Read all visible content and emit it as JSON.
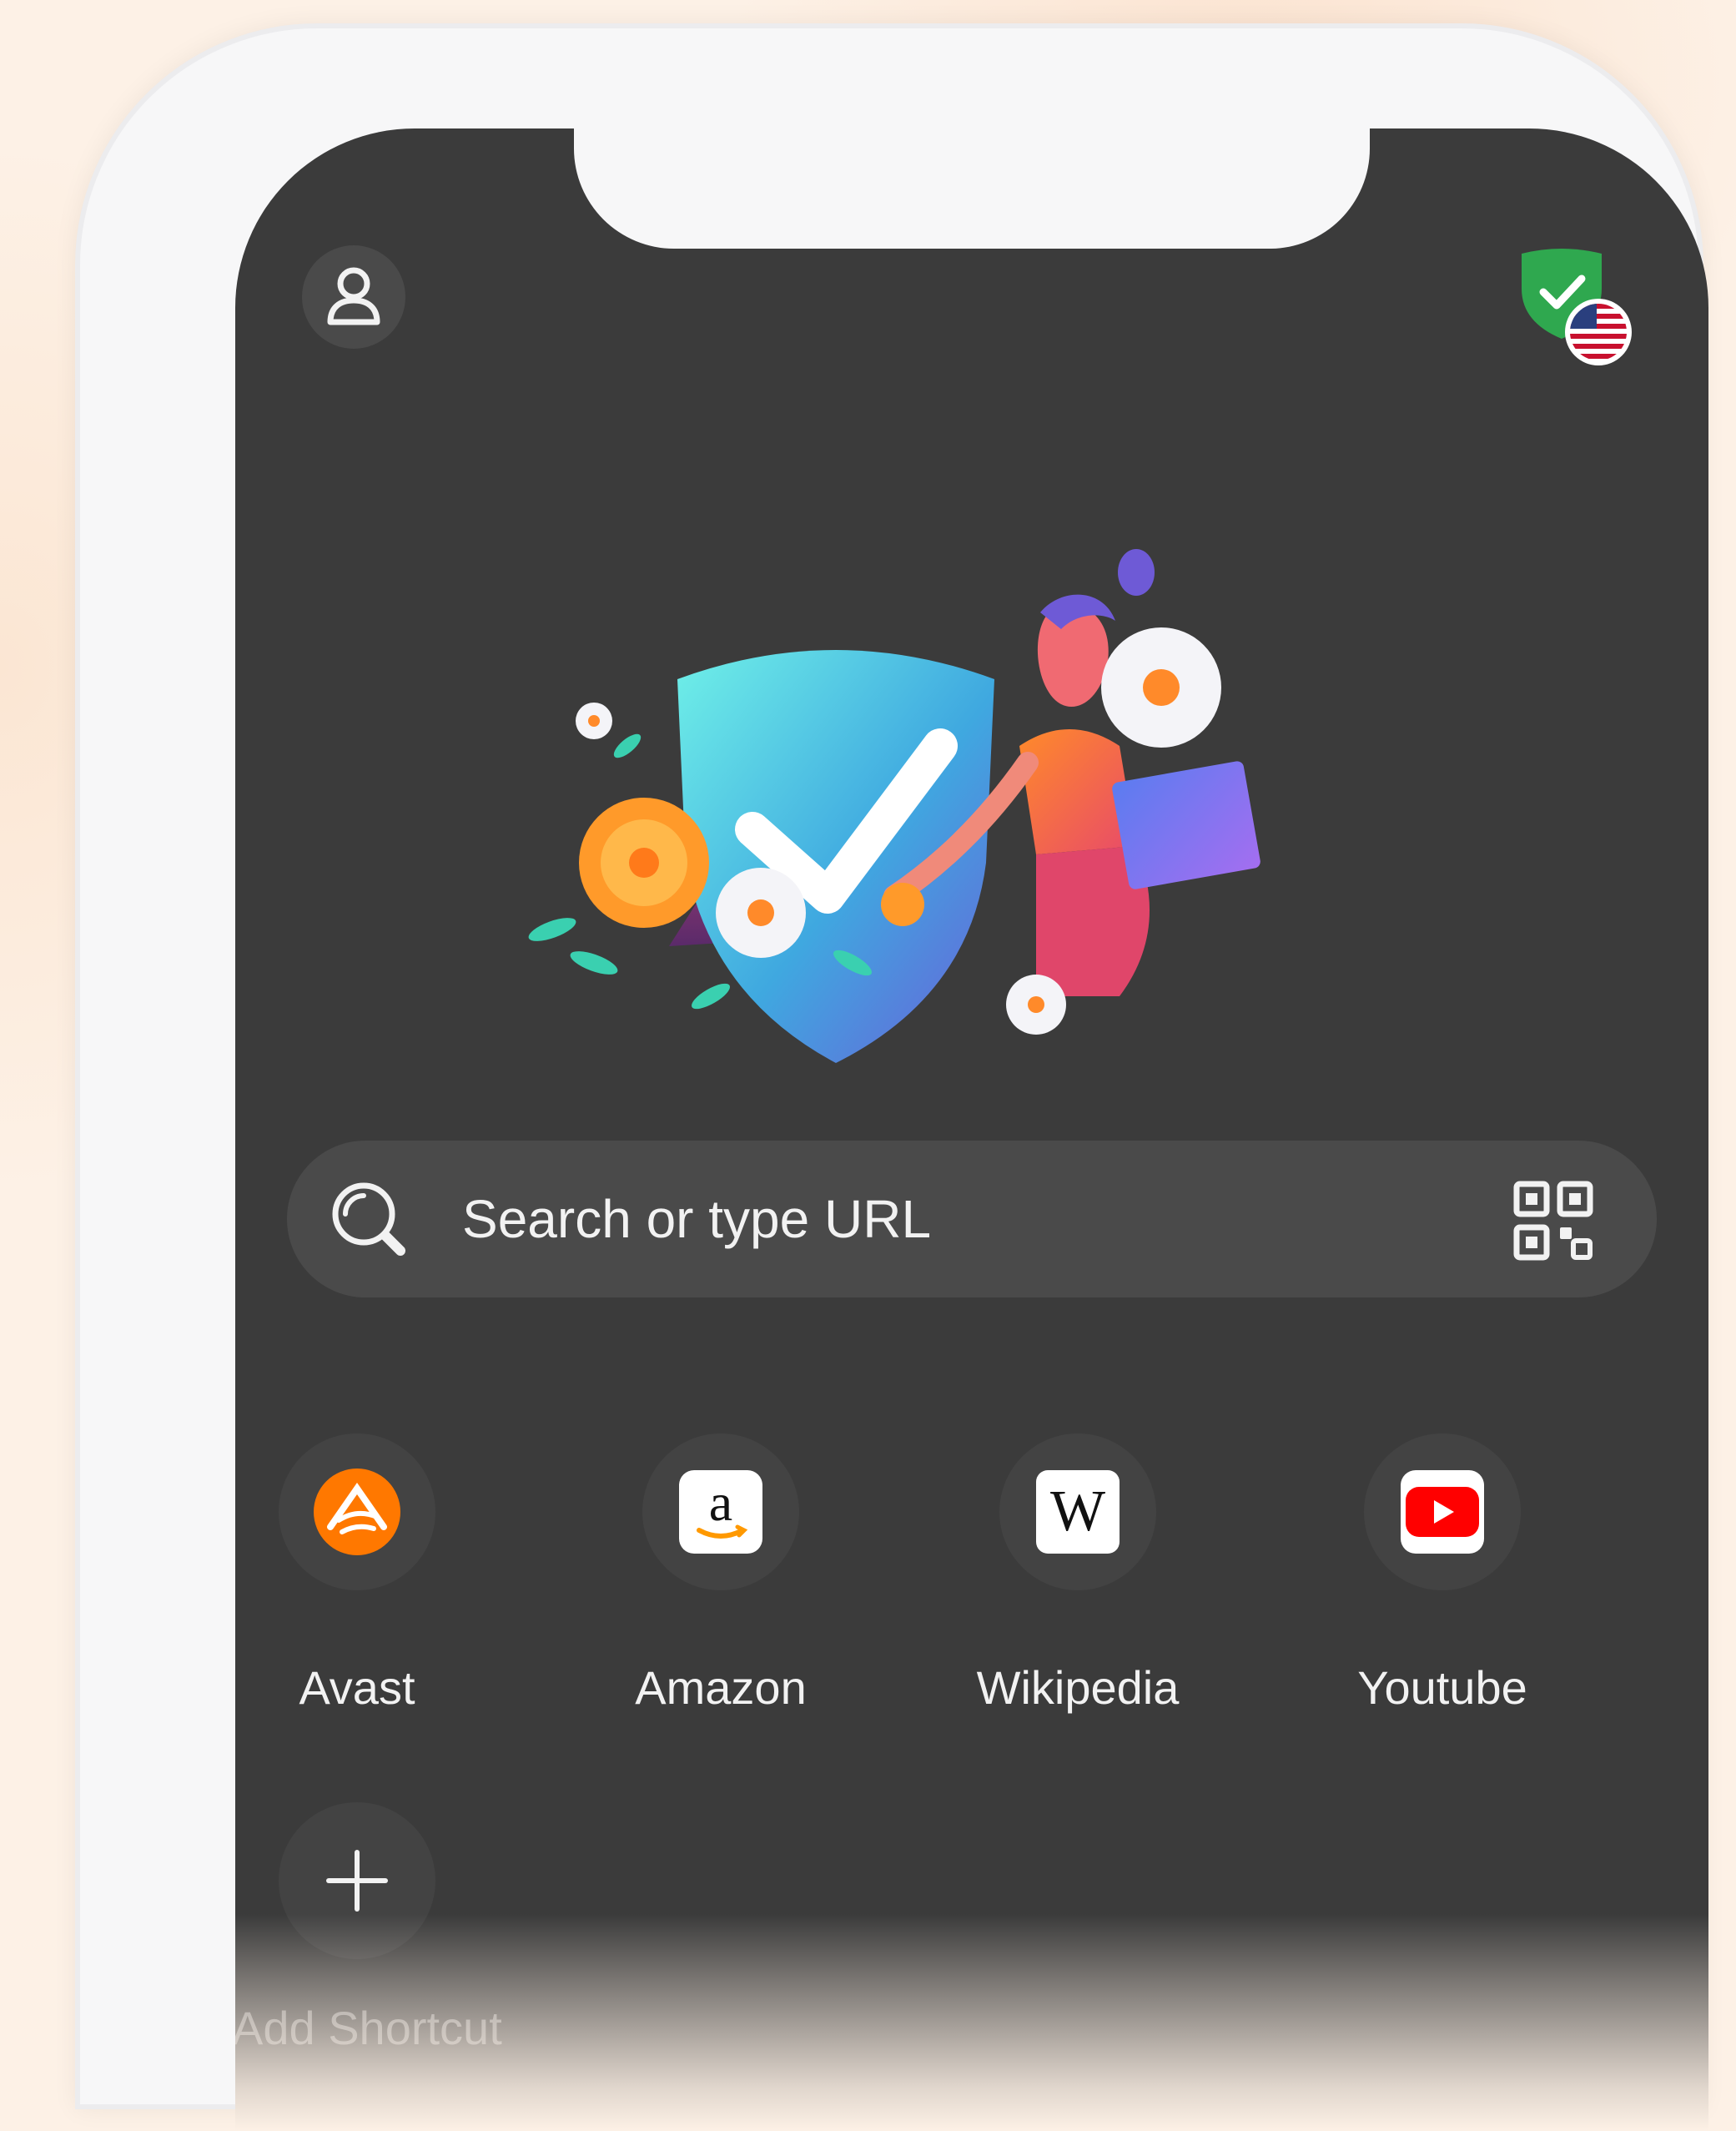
{
  "header": {
    "profile_icon": "user-icon",
    "vpn_status_icon": "shield-check-icon",
    "vpn_region_icon": "us-flag-icon"
  },
  "search": {
    "placeholder": "Search or type URL",
    "search_icon": "search-icon",
    "qr_icon": "qr-code-icon"
  },
  "shortcuts": [
    {
      "label": "Avast",
      "icon": "avast-logo-icon",
      "color": "#ff7800"
    },
    {
      "label": "Amazon",
      "icon": "amazon-logo-icon",
      "color": "#ffffff"
    },
    {
      "label": "Wikipedia",
      "icon": "wikipedia-logo-icon",
      "color": "#ffffff"
    },
    {
      "label": "Youtube",
      "icon": "youtube-logo-icon",
      "color": "#ff0000"
    }
  ],
  "add_shortcut": {
    "label": "Add Shortcut",
    "icon": "plus-icon"
  },
  "colors": {
    "screen_bg": "#3b3b3b",
    "search_bg": "#4a4a4a",
    "shield_green": "#2fa84f"
  }
}
